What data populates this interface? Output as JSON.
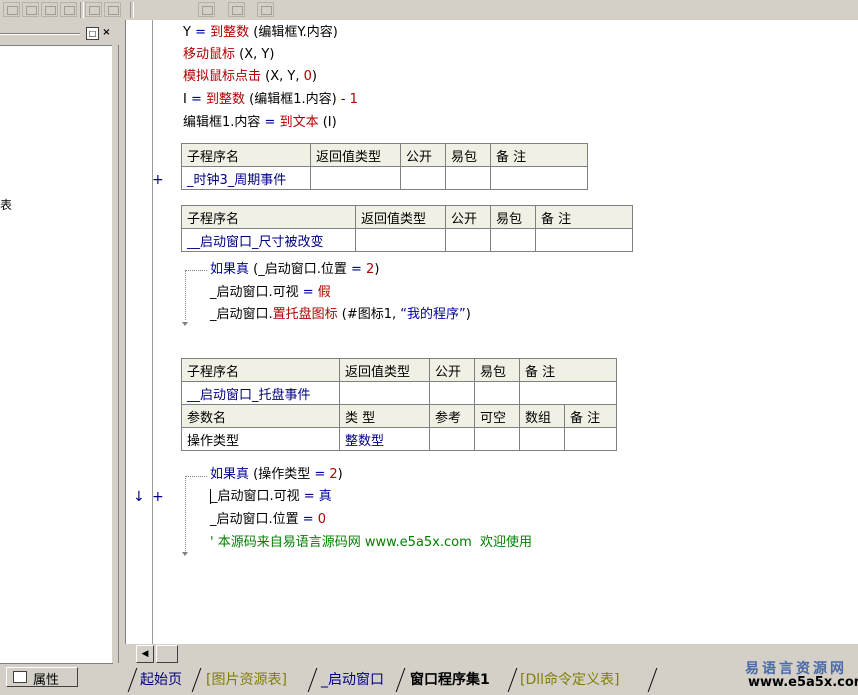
{
  "toolbar": {
    "buttons": [
      "align-left-icon",
      "align-center-icon",
      "align-top-icon",
      "align-middle-icon",
      "distribute-h-icon",
      "distribute-v-icon",
      "same-width-icon",
      "same-height-icon",
      "same-size-icon"
    ]
  },
  "left_panel": {
    "truncated_text": "表",
    "restore_glyph": "□",
    "close_glyph": "×",
    "properties_tab": "属性"
  },
  "code_lines": {
    "line1": {
      "lhs": "Y ",
      "op": "=",
      "fn": " 到整数",
      "rest": " (编辑框Y.内容)"
    },
    "line2": {
      "fn": "移动鼠标",
      "rest": " (X, Y)"
    },
    "line3": {
      "fn": "模拟鼠标点击",
      "rest": " (X, Y, ",
      "num": "0",
      "close": ")"
    },
    "line4": {
      "lhs": "I ",
      "op": "=",
      "fn": " 到整数",
      "rest": " (编辑框1.内容) ",
      "minus": "-",
      "num": " 1"
    },
    "line5": {
      "lhs": "编辑框1.内容 ",
      "op": "=",
      "fn": " 到文本",
      "rest": " (I)"
    }
  },
  "sub1": {
    "headers": [
      "子程序名",
      "返回值类型",
      "公开",
      "易包",
      "备 注"
    ],
    "name": "_时钟3_周期事件",
    "margin_plus": "+"
  },
  "sub2": {
    "headers": [
      "子程序名",
      "返回值类型",
      "公开",
      "易包",
      "备 注"
    ],
    "name": "__启动窗口_尺寸被改变",
    "if_kw": "如果真",
    "if_rest": " (_启动窗口.位置 ",
    "if_op": "=",
    "if_num": " 2",
    "if_close": ")",
    "l1_lhs": "_启动窗口.可视 ",
    "l1_op": "=",
    "l1_val": " 假",
    "l2_obj": "_启动窗口.",
    "l2_fn": "置托盘图标",
    "l2_args": " (#图标1, ",
    "l2_str": "“我的程序”",
    "l2_close": ")"
  },
  "sub3": {
    "headers": [
      "子程序名",
      "返回值类型",
      "公开",
      "易包",
      "备 注"
    ],
    "name": "__启动窗口_托盘事件",
    "param_headers": [
      "参数名",
      "类 型",
      "参考",
      "可空",
      "数组",
      "备 注"
    ],
    "param_name": "操作类型",
    "param_type": "整数型",
    "if_kw": "如果真",
    "if_rest": " (操作类型 ",
    "if_op": "=",
    "if_num": " 2",
    "if_close": ")",
    "l1_lhs": "_启动窗口.可视 ",
    "l1_op": "=",
    "l1_val": " 真",
    "l2_lhs": "_启动窗口.位置 ",
    "l2_op": "=",
    "l2_val": " 0",
    "comment": "' 本源码来自易语言源码网 www.e5a5x.com  欢迎使用",
    "margin_arrow": "↓",
    "margin_plus": "+"
  },
  "scroll": {
    "left_arrow": "◀"
  },
  "tabs": [
    "起始页",
    "[图片资源表]",
    "_启动窗口",
    "窗口程序集1",
    "[Dll命令定义表]"
  ],
  "watermark": {
    "line1": "易语言资源网",
    "line2": "www.e5a5x.com"
  },
  "colors": {
    "keyword": "#0000a0",
    "function": "#b00000",
    "comment": "#008000",
    "header_bg": "#f0f0e4",
    "panel_bg": "#d4d0c8"
  }
}
